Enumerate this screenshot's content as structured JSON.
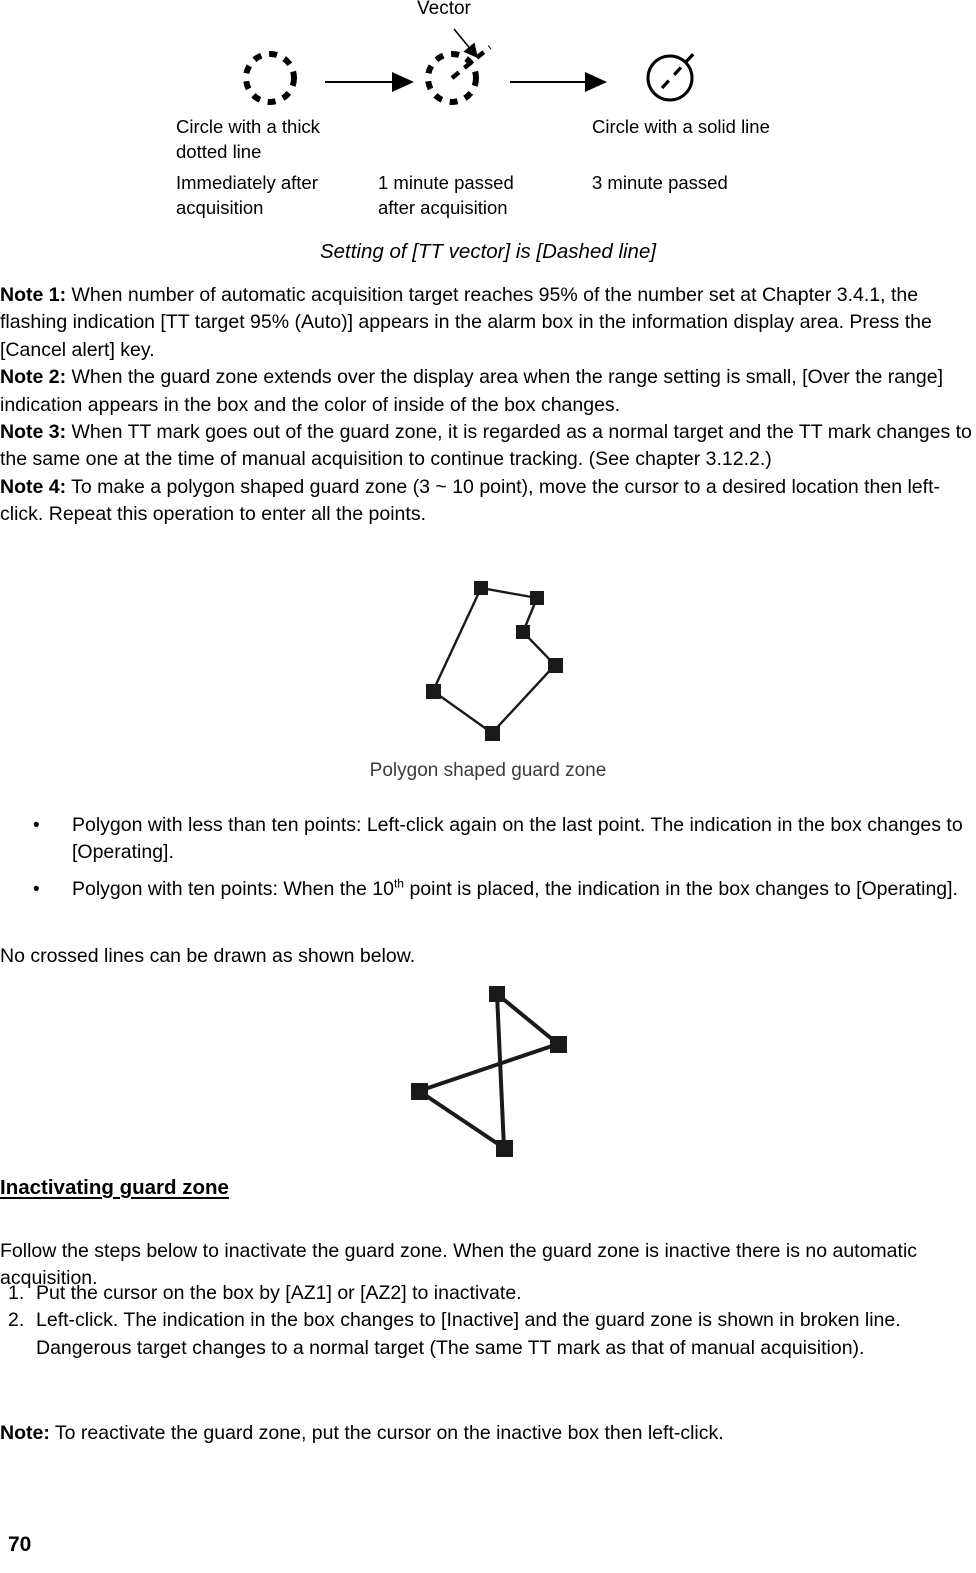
{
  "page": {
    "number": "70"
  },
  "top_figure": {
    "vector_label": "Vector",
    "captions": {
      "thick_dotted": "Circle with a thick\ndotted line",
      "solid": "Circle with a solid line",
      "immediately": "Immediately after\nacquisition",
      "one_minute": "1 minute passed\nafter acquisition",
      "three_minute": "3 minute passed"
    }
  },
  "figure_caption": "Setting of [TT vector] is [Dashed line]",
  "notes": {
    "note1_label": "Note 1:",
    "note1_text": " When number of automatic acquisition target reaches 95% of the number set at Chapter 3.4.1, the flashing indication [TT target 95% (Auto)] appears in the alarm box in the information display area. Press the [Cancel alert] key.",
    "note2_label": "Note 2:",
    "note2_text": " When the guard zone extends over the display area when the range setting is small, [Over the range] indication appears in the box and the color of inside of the box changes.",
    "note3_label": "Note 3:",
    "note3_text": " When TT mark goes out of the guard zone, it is regarded as a normal target and the TT mark changes to the same one at the time of manual acquisition to continue tracking. (See chapter 3.12.2.)",
    "note4_label": "Note 4:",
    "note4_text": " To make a polygon shaped guard zone (3 ~ 10 point), move the cursor to a desired location then left-click. Repeat this operation to enter all the points."
  },
  "polygon_figure": {
    "caption": "Polygon shaped guard zone"
  },
  "bullets": {
    "marker": "•",
    "item1": "Polygon with less than ten points: Left-click again on the last point. The indication in the box changes to [Operating].",
    "item2_pre": "Polygon with ten points: When the 10",
    "item2_sup": "th",
    "item2_post": " point is placed, the indication in the box changes to [Operating]."
  },
  "no_crossed_lines": "No crossed lines can be drawn as shown below.",
  "section": {
    "heading": "Inactivating guard zone",
    "intro": "Follow the steps below to inactivate the guard zone. When the guard zone is inactive there is no automatic acquisition.",
    "step1_num": "1.",
    "step1_text": "Put the cursor on the box by [AZ1] or [AZ2] to inactivate.",
    "step2_num": "2.",
    "step2_text": "Left-click. The indication in the box changes to [Inactive] and the guard zone is shown in broken line. Dangerous target changes to a normal target (The same TT mark as that of manual acquisition).",
    "note_label": "Note:",
    "note_text": " To reactivate the guard zone, put the cursor on the inactive box then left-click."
  },
  "colors": {
    "text": "#000000",
    "caption_gray": "#3b3b3b",
    "background": "#ffffff"
  }
}
